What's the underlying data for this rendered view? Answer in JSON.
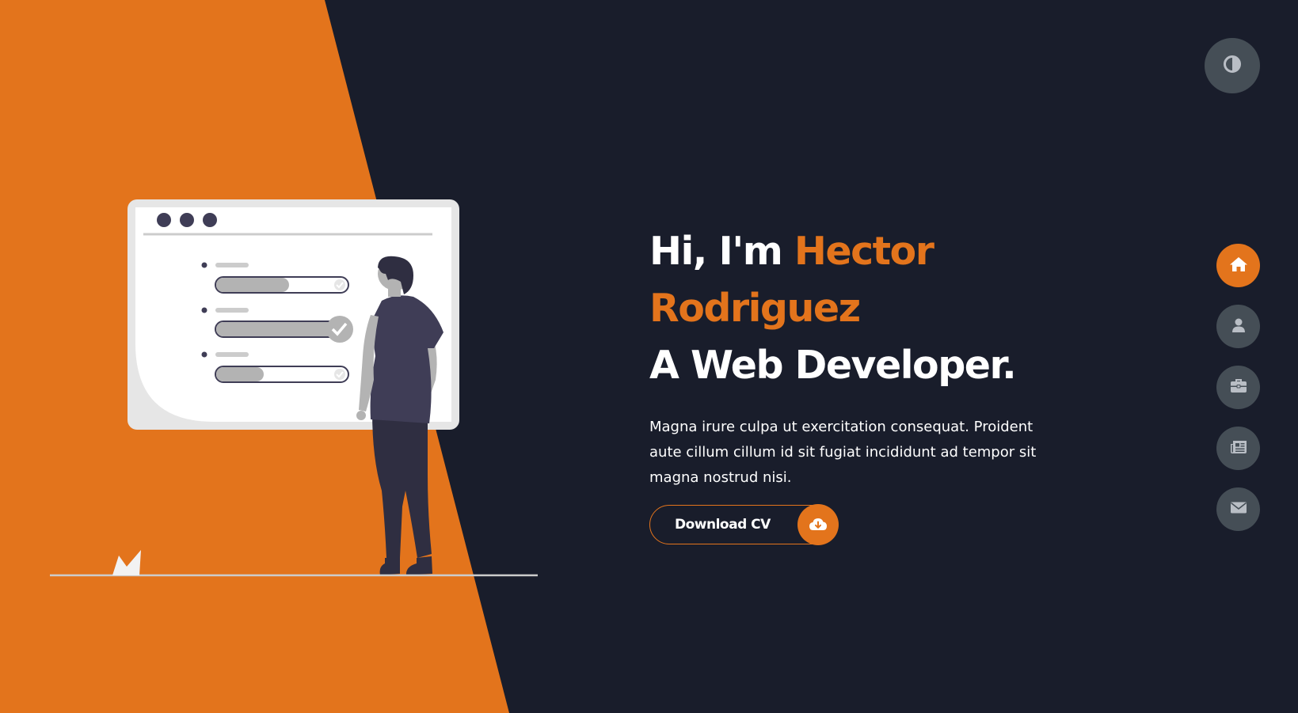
{
  "hero": {
    "greeting": "Hi, I'm",
    "name_first": "Hector",
    "name_last": "Rodriguez",
    "role": "A Web Developer.",
    "description": "Magna irure culpa ut exercitation consequat. Proident aute cillum cillum id sit fugiat incididunt ad tempor sit magna nostrud nisi.",
    "cta_label": "Download CV",
    "cta_icon": "cloud-download-icon"
  },
  "theme_toggle": {
    "icon": "contrast-icon"
  },
  "nav": {
    "items": [
      {
        "icon": "home-icon",
        "active": true
      },
      {
        "icon": "user-icon",
        "active": false
      },
      {
        "icon": "briefcase-icon",
        "active": false
      },
      {
        "icon": "newspaper-icon",
        "active": false
      },
      {
        "icon": "envelope-icon",
        "active": false
      }
    ]
  },
  "colors": {
    "accent": "#e3741c",
    "background": "#191d2b",
    "button_gray": "#454e56",
    "text": "#ffffff"
  }
}
